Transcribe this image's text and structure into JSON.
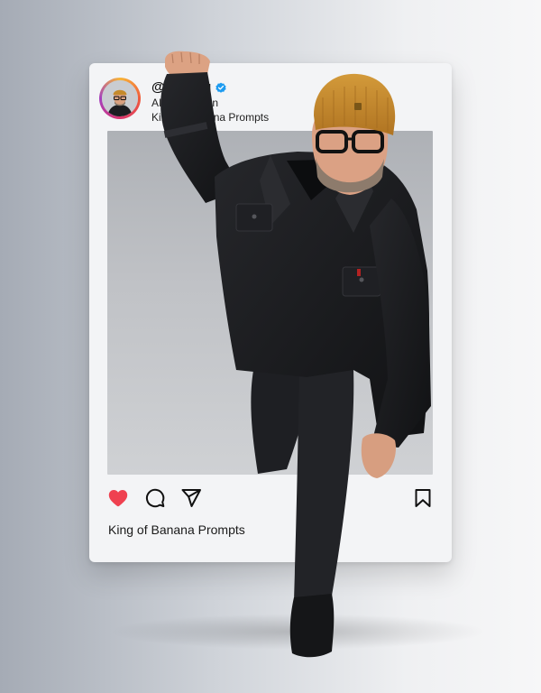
{
  "post": {
    "username": "@mickeq",
    "bio_line_1": "AI Generation",
    "bio_line_2": "King of Banana Prompts",
    "caption": "King of Banana Prompts"
  },
  "icons": {
    "verified": "verified-badge-icon",
    "like": "heart-icon",
    "comment": "comment-bubble-icon",
    "share": "paper-plane-icon",
    "save": "bookmark-icon"
  },
  "colors": {
    "like_active": "#ef4150",
    "verified": "#1d9bf0",
    "beanie": "#c58a2c",
    "jacket": "#1b1c1f"
  }
}
